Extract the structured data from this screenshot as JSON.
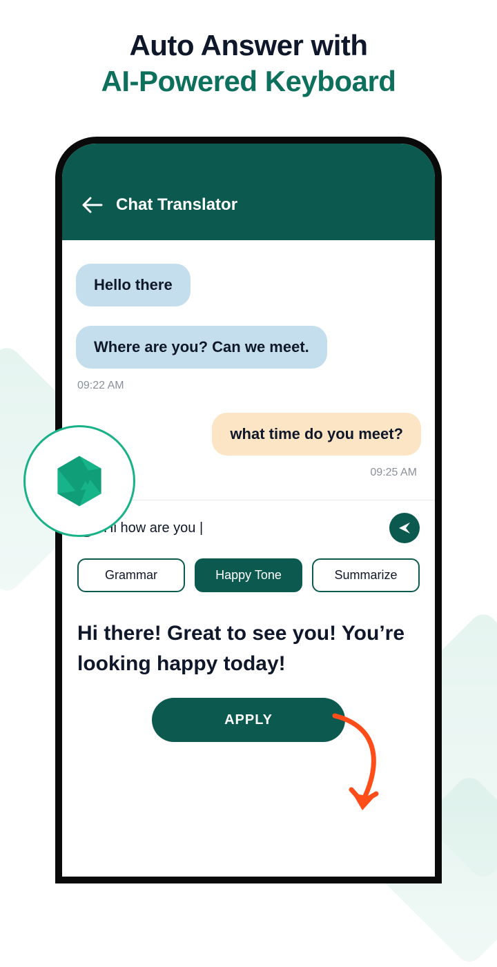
{
  "hero": {
    "line1": "Auto Answer with",
    "line2": "AI-Powered Keyboard"
  },
  "app": {
    "title": "Chat Translator"
  },
  "chat": {
    "in1": "Hello there",
    "in2": "Where are you? Can we meet.",
    "time_in": "09:22 AM",
    "out1": "what time do you meet?",
    "time_out": "09:25 AM"
  },
  "composer": {
    "input": "Hi how are you |"
  },
  "chips": {
    "grammar": "Grammar",
    "happy": "Happy Tone",
    "summarize": "Summarize"
  },
  "result": "Hi there! Great to see you! You’re looking happy today!",
  "apply": "APPLY"
}
